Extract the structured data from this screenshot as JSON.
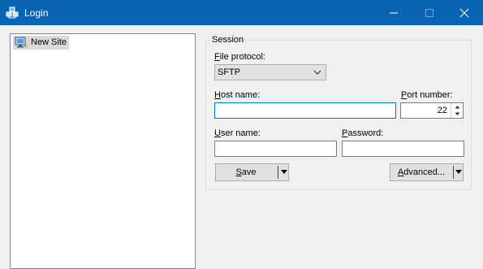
{
  "window": {
    "title": "Login",
    "icon": "winscp-login-icon"
  },
  "titlebar_buttons": [
    {
      "name": "minimize-icon"
    },
    {
      "name": "maximize-icon"
    },
    {
      "name": "close-icon"
    }
  ],
  "site_tree": {
    "items": [
      {
        "label": "New Site",
        "icon": "computer-site-icon",
        "selected": true
      }
    ]
  },
  "session": {
    "group_label": "Session",
    "file_protocol": {
      "label_key": "F",
      "label_rest": "ile protocol:",
      "value": "SFTP"
    },
    "host_name": {
      "label_key": "H",
      "label_rest": "ost name:",
      "value": ""
    },
    "port_number": {
      "label_key": "P",
      "label_rest": "ort number:",
      "value": "22"
    },
    "user_name": {
      "label_key": "U",
      "label_rest": "ser name:",
      "value": ""
    },
    "password": {
      "label_key": "P",
      "label_rest": "assword:",
      "value": ""
    },
    "save_button": {
      "key": "S",
      "rest": "ave"
    },
    "advanced_button": {
      "key": "A",
      "rest": "dvanced..."
    }
  },
  "colors": {
    "titlebar": "#0a64b4",
    "focus_border": "#0078d7",
    "selection": "#d9d9d9"
  }
}
